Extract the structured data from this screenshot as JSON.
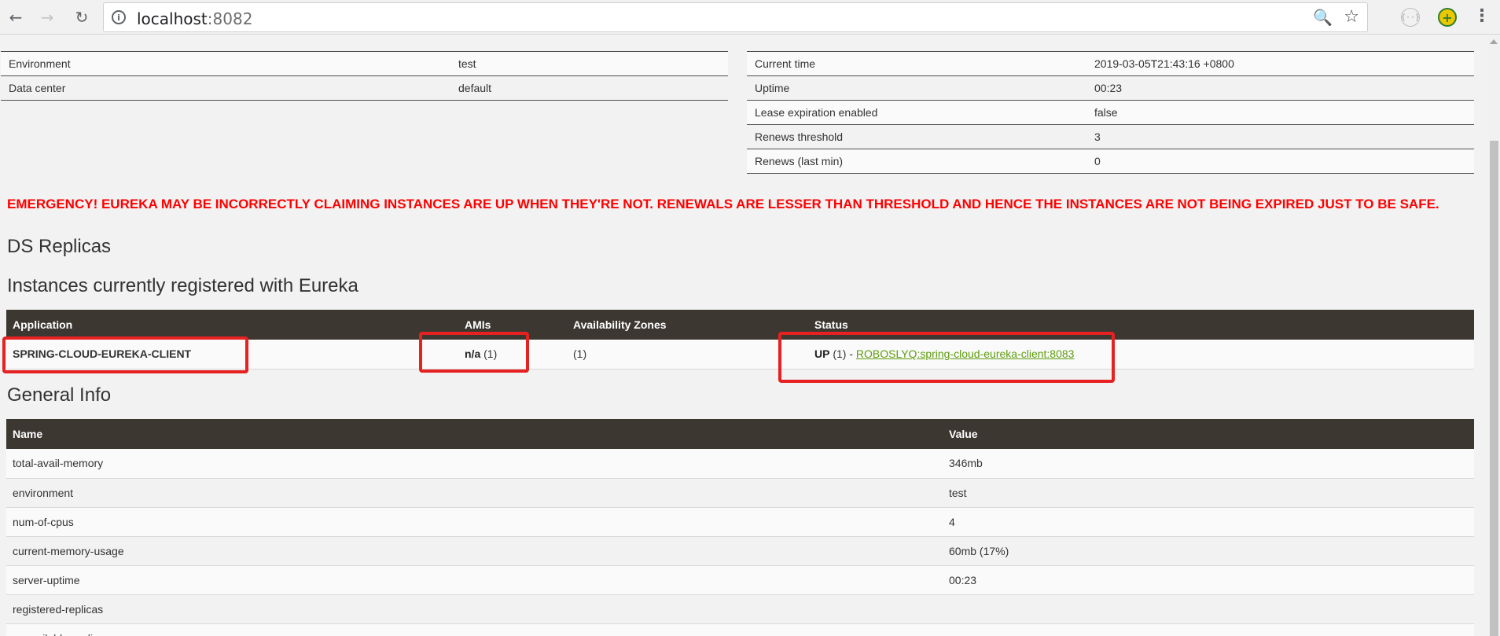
{
  "browser": {
    "back_icon": "←",
    "forward_icon": "→",
    "reload_icon": "↻",
    "info_icon": "i",
    "url_host": "localhost",
    "url_port": ":8082",
    "zoom_icon": "🔍",
    "star_icon": "☆",
    "ext1_icon": "{··}",
    "ext2_icon": "+",
    "menu_icon": "⋮"
  },
  "env_table": [
    {
      "label": "Environment",
      "value": "test"
    },
    {
      "label": "Data center",
      "value": "default"
    }
  ],
  "status_table": [
    {
      "label": "Current time",
      "value": "2019-03-05T21:43:16 +0800"
    },
    {
      "label": "Uptime",
      "value": "00:23"
    },
    {
      "label": "Lease expiration enabled",
      "value": "false"
    },
    {
      "label": "Renews threshold",
      "value": "3"
    },
    {
      "label": "Renews (last min)",
      "value": "0"
    }
  ],
  "emergency": "EMERGENCY! EUREKA MAY BE INCORRECTLY CLAIMING INSTANCES ARE UP WHEN THEY'RE NOT. RENEWALS ARE LESSER THAN THRESHOLD AND HENCE THE INSTANCES ARE NOT BEING EXPIRED JUST TO BE SAFE.",
  "ds_replicas_title": "DS Replicas",
  "instances_title": "Instances currently registered with Eureka",
  "instances_headers": [
    "Application",
    "AMIs",
    "Availability Zones",
    "Status"
  ],
  "instance_row": {
    "application": "SPRING-CLOUD-EUREKA-CLIENT",
    "ami_value": "n/a",
    "ami_count": "(1)",
    "zones": "(1)",
    "status_label": "UP",
    "status_count": "(1) -",
    "status_link": "ROBOSLYQ:spring-cloud-eureka-client:8083"
  },
  "general_info_title": "General Info",
  "general_headers": [
    "Name",
    "Value"
  ],
  "general_rows": [
    {
      "name": "total-avail-memory",
      "value": "346mb"
    },
    {
      "name": "environment",
      "value": "test"
    },
    {
      "name": "num-of-cpus",
      "value": "4"
    },
    {
      "name": "current-memory-usage",
      "value": "60mb (17%)"
    },
    {
      "name": "server-uptime",
      "value": "00:23"
    },
    {
      "name": "registered-replicas",
      "value": ""
    },
    {
      "name": "unavailable-replicas",
      "value": ""
    }
  ]
}
